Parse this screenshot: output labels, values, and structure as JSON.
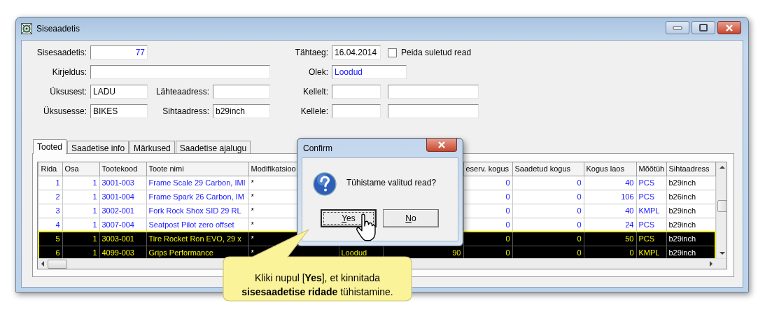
{
  "window": {
    "title": "Siseaadetis"
  },
  "form": {
    "sisesaadetis": {
      "label": "Sisesaadetis:",
      "value": "77",
      "readonly": true
    },
    "kirjeldus": {
      "label": "Kirjeldus:"
    },
    "uksusest": {
      "label": "Üksusest:",
      "value": "LADU",
      "readonly": false
    },
    "lahteaadress": {
      "label": "Lähteaadress:"
    },
    "uksusesse": {
      "label": "Üksusesse:",
      "value": "BIKES",
      "readonly": false
    },
    "sihtaadress": {
      "label": "Sihtaadress:",
      "value": "b29inch",
      "readonly": false
    },
    "tahtaeg": {
      "label": "Tähtaeg:",
      "value": "16.04.2014",
      "readonly": false
    },
    "peida": {
      "label": "Peida suletud read",
      "checked": false
    },
    "olek": {
      "label": "Olek:",
      "value": "Loodud",
      "readonly": true
    },
    "kellelt": {
      "label": "Kellelt:"
    },
    "kellele": {
      "label": "Kellele:"
    }
  },
  "tabs": [
    {
      "label": "Tooted",
      "selected": true
    },
    {
      "label": "Saadetise info",
      "selected": false
    },
    {
      "label": "Märkused",
      "selected": false
    },
    {
      "label": "Saadetise ajalugu",
      "selected": false
    }
  ],
  "table": {
    "columns": {
      "rida": "Rida",
      "osa": "Osa",
      "tootekood": "Tootekood",
      "toote_nimi": "Toote nimi",
      "modifikatsioon": "Modifikatsioo",
      "reserv_kogus": "eserv. kogus",
      "saadetud_kogus": "Saadetud kogus",
      "kogus_laos": "Kogus laos",
      "mootuhik": "Mõõtüh",
      "sihtaadress": "Sihtaadress"
    },
    "rows": [
      {
        "rida": "1",
        "osa": "1",
        "tootekood": "3001-003",
        "toote_nimi": "Frame Scale 29 Carbon, IMI",
        "modifikatsioon": "*",
        "reserv_kogus": "0",
        "saadetud_kogus": "0",
        "kogus_laos": "40",
        "mootuhik": "PCS",
        "sihtaadress": "b29inch",
        "selected": false
      },
      {
        "rida": "2",
        "osa": "1",
        "tootekood": "3001-004",
        "toote_nimi": "Frame Spark 26 Carbon, IM",
        "modifikatsioon": "*",
        "reserv_kogus": "0",
        "saadetud_kogus": "0",
        "kogus_laos": "106",
        "mootuhik": "PCS",
        "sihtaadress": "b26inch",
        "selected": false
      },
      {
        "rida": "3",
        "osa": "1",
        "tootekood": "3002-001",
        "toote_nimi": "Fork Rock Shox SID 29 RL",
        "modifikatsioon": "*",
        "reserv_kogus": "0",
        "saadetud_kogus": "0",
        "kogus_laos": "40",
        "mootuhik": "KMPL",
        "sihtaadress": "b29inch",
        "selected": false
      },
      {
        "rida": "4",
        "osa": "1",
        "tootekood": "3007-004",
        "toote_nimi": "Seatpost Pilot zero offset",
        "modifikatsioon": "*",
        "reserv_kogus": "0",
        "saadetud_kogus": "0",
        "kogus_laos": "24",
        "mootuhik": "PCS",
        "sihtaadress": "b29inch",
        "selected": false
      },
      {
        "rida": "5",
        "osa": "1",
        "tootekood": "3003-001",
        "toote_nimi": "Tire Rocket Ron EVO, 29 x",
        "modifikatsioon": "*",
        "reserv_kogus": "0",
        "saadetud_kogus": "0",
        "kogus_laos": "50",
        "mootuhik": "PCS",
        "sihtaadress": "b29inch",
        "selected": true
      },
      {
        "rida": "6",
        "osa": "1",
        "tootekood": "4099-003",
        "toote_nimi": "Grips Performance",
        "modifikatsioon": "*",
        "column_6": "Loodud",
        "column_7": "90",
        "reserv_kogus": "0",
        "saadetud_kogus": "0",
        "kogus_laos": "0",
        "mootuhik": "KMPL",
        "sihtaadress": "b29inch",
        "selected": true
      }
    ]
  },
  "dialog": {
    "title": "Confirm",
    "message": "Tühistame valitud read?",
    "buttons": [
      {
        "label": "Yes",
        "focused": true
      },
      {
        "label": "No",
        "focused": false
      }
    ]
  },
  "callout": {
    "text": "Kliki nupul [**Yes**], et kinnitada **sisesaadetise ridade** tühistamine."
  }
}
